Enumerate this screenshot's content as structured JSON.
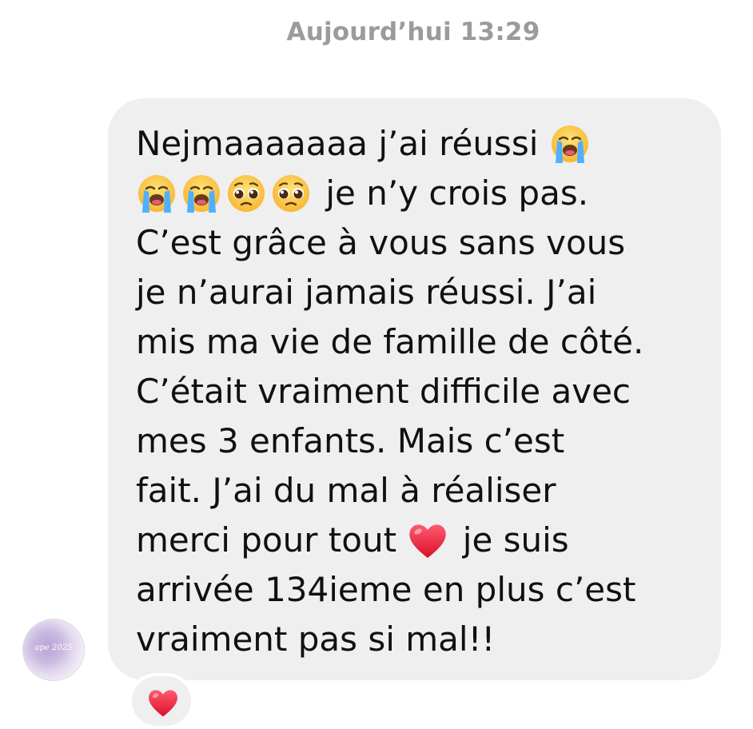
{
  "header": {
    "timestamp": "Aujourd’hui 13:29"
  },
  "message": {
    "lines": [
      "Nejmaaaaaaa j’ai réussi",
      "je n’y crois pas.",
      "C’est grâce à vous sans vous",
      "je n’aurai jamais réussi. J’ai",
      "mis ma vie de famille de côté.",
      "C’était vraiment difficile avec",
      "mes 3 enfants. Mais c’est",
      "fait. J’ai du mal à réaliser",
      "merci pour tout",
      "je suis",
      "arrivée 134ieme en plus c’est",
      "vraiment pas si mal!!"
    ],
    "emojis": [
      "loudly-crying-face-icon",
      "pleading-face-icon",
      "red-heart-icon"
    ]
  },
  "avatar": {
    "text": "ape 2025"
  },
  "reaction": {
    "emoji": "red-heart-icon"
  },
  "colors": {
    "bubble": "#efeff0",
    "timestamp": "#9b9b9b",
    "text": "#101010",
    "heart": "#e8223a"
  }
}
